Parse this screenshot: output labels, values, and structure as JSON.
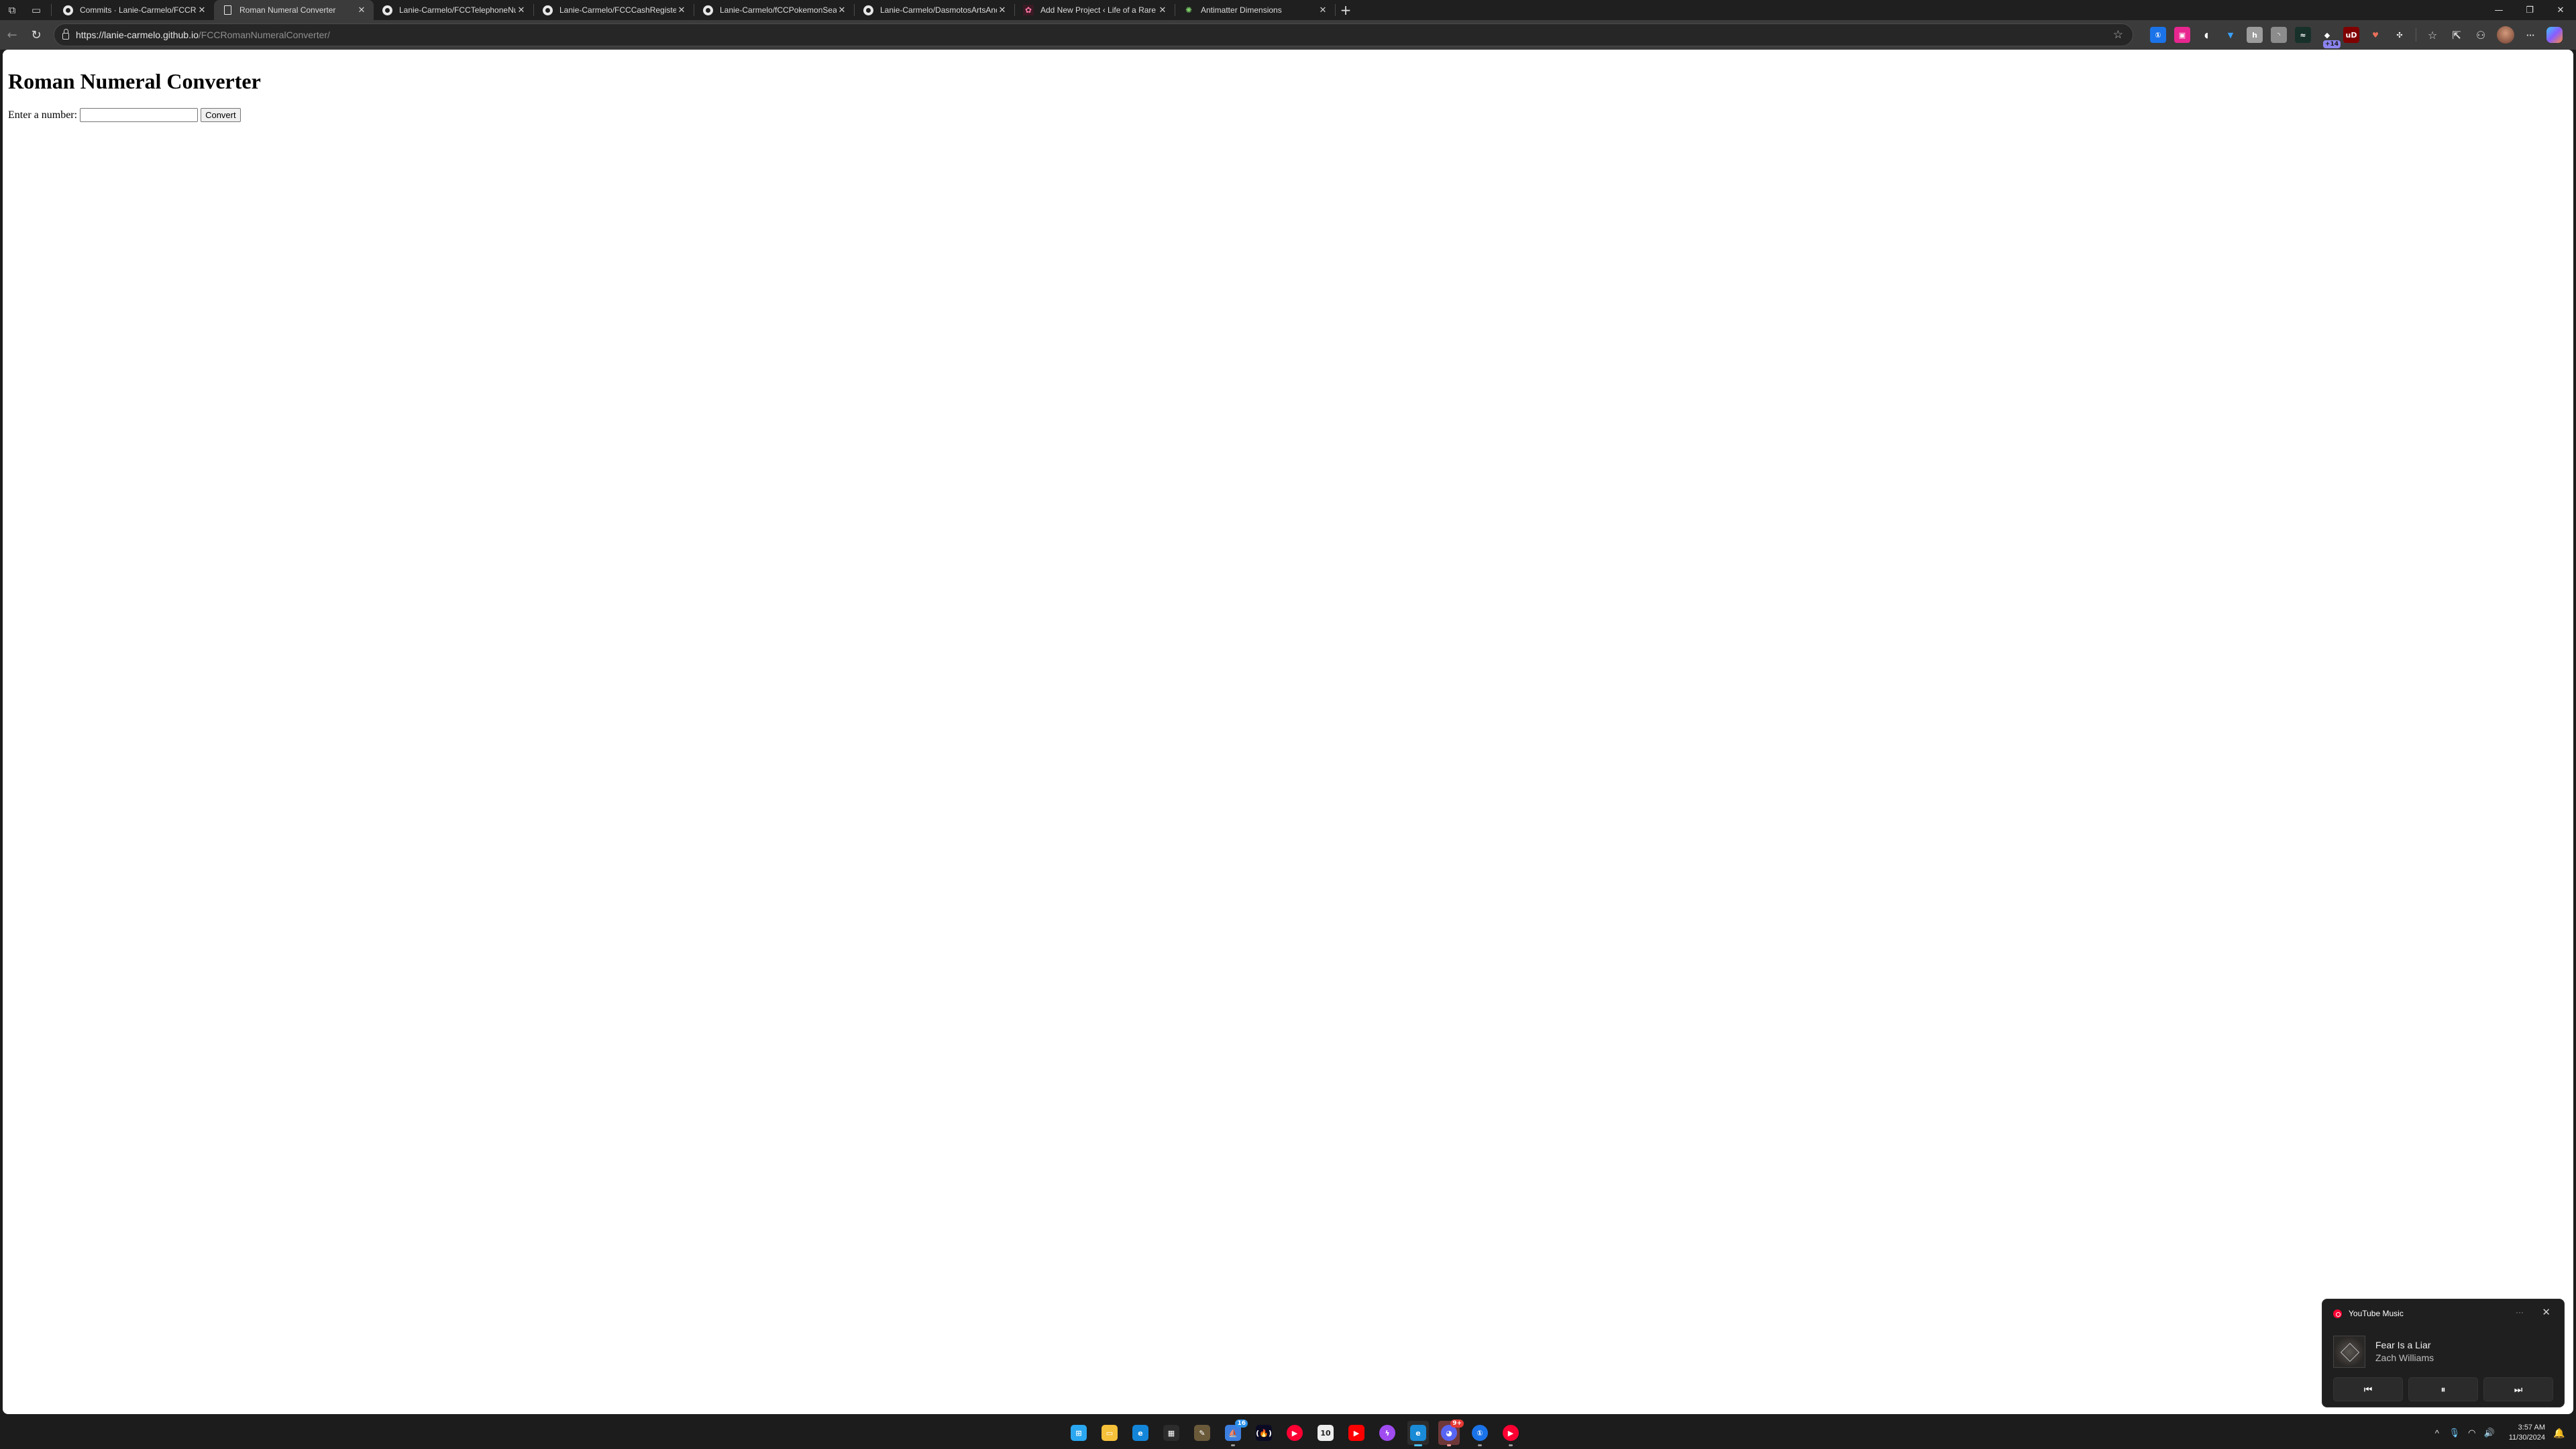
{
  "browser": {
    "tabs": [
      {
        "label": "Commits · Lanie-Carmelo/FCCRo",
        "favicon": "github-icon",
        "active": false
      },
      {
        "label": "Roman Numeral Converter",
        "favicon": "document-icon",
        "active": true
      },
      {
        "label": "Lanie-Carmelo/FCCTelephoneNu",
        "favicon": "github-icon",
        "active": false
      },
      {
        "label": "Lanie-Carmelo/FCCCashRegister",
        "favicon": "github-icon",
        "active": false
      },
      {
        "label": "Lanie-Carmelo/fCCPokemonSear",
        "favicon": "github-icon",
        "active": false
      },
      {
        "label": "Lanie-Carmelo/DasmotosArtsAnd",
        "favicon": "github-icon",
        "active": false
      },
      {
        "label": "Add New Project ‹ Life of a Rare B",
        "favicon": "site-icon",
        "active": false
      },
      {
        "label": "Antimatter Dimensions",
        "favicon": "antimatter-icon",
        "active": false
      }
    ],
    "tab_close_glyph": "✕",
    "new_tab_glyph": "+",
    "window_controls": {
      "minimize": "—",
      "restore": "❐",
      "close": "✕"
    },
    "nav": {
      "back": "←",
      "reload": "↻"
    },
    "address": {
      "host": "https://lanie-carmelo.github.io",
      "path": "/FCCRomanNumeralConverter/"
    },
    "favorite_glyph": "☆",
    "extensions": [
      {
        "name": "1password",
        "glyph": "①",
        "bg": "#1a73e8"
      },
      {
        "name": "pink-extension",
        "glyph": "▣",
        "bg": "#e8268f"
      },
      {
        "name": "chat-extension",
        "glyph": "◖",
        "bg": "#3b3b3b"
      },
      {
        "name": "gem-extension",
        "glyph": "▼",
        "bg": "#3b3b3b"
      },
      {
        "name": "h-extension",
        "glyph": "h",
        "bg": "#9c9c9c"
      },
      {
        "name": "rss-extension",
        "glyph": "◝",
        "bg": "#8c8c8c"
      },
      {
        "name": "s-extension",
        "glyph": "≈",
        "bg": "#17312a"
      },
      {
        "name": "multi-extension",
        "glyph": "◆",
        "bg": "#3b3b3b",
        "badge": "+14"
      },
      {
        "name": "ublock-origin",
        "glyph": "uD",
        "bg": "#800000"
      },
      {
        "name": "heart-extension",
        "glyph": "♥",
        "bg": "#3b3b3b"
      },
      {
        "name": "extensions-puzzle",
        "glyph": "✣",
        "bg": "#3b3b3b"
      }
    ],
    "toolbar_actions": [
      {
        "name": "favorites",
        "glyph": "☆"
      },
      {
        "name": "share",
        "glyph": "⇱"
      },
      {
        "name": "feedback",
        "glyph": "⚇"
      }
    ],
    "menu_glyph": "···",
    "copilot_glyph": "◈"
  },
  "page": {
    "heading": "Roman Numeral Converter",
    "input_label": "Enter a number:",
    "input_value": "",
    "input_placeholder": "",
    "convert_label": "Convert"
  },
  "media": {
    "app_name": "YouTube Music",
    "more_glyph": "···",
    "close_glyph": "✕",
    "track_title": "Fear Is a Liar",
    "artist": "Zach Williams",
    "prev_glyph": "⏮",
    "pause_glyph": "⏸",
    "next_glyph": "⏭"
  },
  "taskbar": {
    "apps": [
      {
        "name": "start",
        "glyph": "⊞",
        "bg": "#2aa7f0",
        "state": ""
      },
      {
        "name": "file-explorer",
        "glyph": "▭",
        "bg": "#f5c03a",
        "state": ""
      },
      {
        "name": "edge",
        "glyph": "e",
        "bg": "#1486d9",
        "state": ""
      },
      {
        "name": "microsoft-store",
        "glyph": "▦",
        "bg": "#2c2c2c",
        "state": ""
      },
      {
        "name": "file-manager",
        "glyph": "✎",
        "bg": "#6b5a3a",
        "state": ""
      },
      {
        "name": "sailboat-app",
        "glyph": "⛵",
        "bg": "#3d7fe0",
        "state": "running",
        "badge": "16",
        "badge_color": "#2b8fe8"
      },
      {
        "name": "freecodecamp",
        "glyph": "(🔥)",
        "bg": "#0a0a23",
        "state": ""
      },
      {
        "name": "youtube-music",
        "glyph": "▶",
        "bg": "#ff0033",
        "state": ""
      },
      {
        "name": "sketch-app",
        "glyph": "10",
        "bg": "#eeeeee",
        "state": ""
      },
      {
        "name": "youtube",
        "glyph": "▶",
        "bg": "#ff0000",
        "state": ""
      },
      {
        "name": "messenger",
        "glyph": "ϟ",
        "bg": "#a04cf0",
        "state": ""
      },
      {
        "name": "edge-beta",
        "glyph": "e",
        "bg": "#1a8bd6",
        "state": "focused"
      },
      {
        "name": "discord",
        "glyph": "◕",
        "bg": "#5865f2",
        "state": "alert",
        "badge": "9+",
        "badge_color": "#e53935"
      },
      {
        "name": "1password",
        "glyph": "①",
        "bg": "#1a73e8",
        "state": "running"
      },
      {
        "name": "youtube-music-2",
        "glyph": "▶",
        "bg": "#ff0033",
        "state": "running"
      }
    ],
    "tray": {
      "chevron": "^",
      "mic": "🎙",
      "wifi": "◠",
      "volume": "🔊",
      "time": "3:57 AM",
      "date": "11/30/2024",
      "bell": "🔔"
    }
  }
}
